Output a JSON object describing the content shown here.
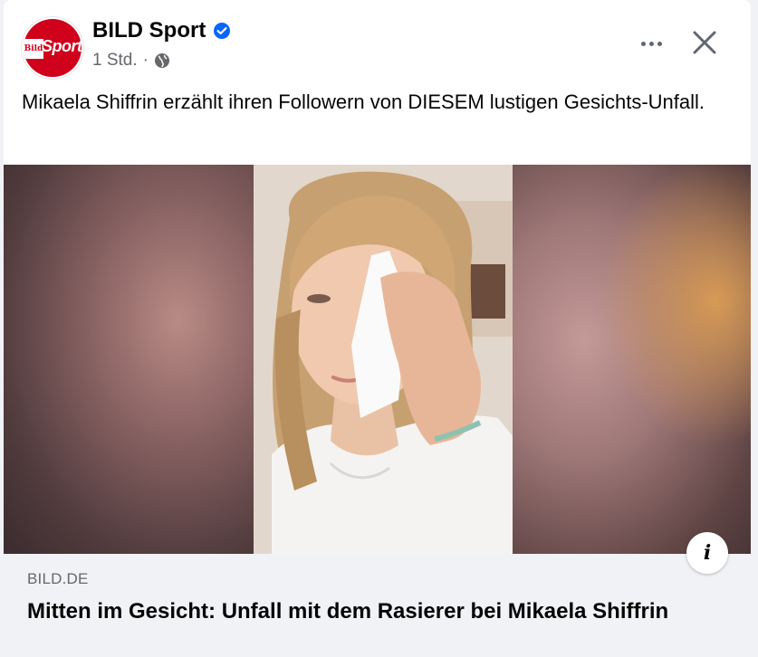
{
  "post": {
    "page_name": "BILD Sport",
    "verified_icon": "verified-badge-icon",
    "timestamp": "1 Std.",
    "separator": "·",
    "audience_icon": "globe-icon",
    "text": "Mikaela Shiffrin erzählt ihren Followern von DIESEM lustigen Gesichts-Unfall.",
    "avatar": {
      "logo_left": "Bild",
      "logo_right": "Sport"
    }
  },
  "actions": {
    "more_icon": "more-options-icon",
    "close_icon": "close-icon"
  },
  "link": {
    "domain": "BILD.DE",
    "title": "Mitten im Gesicht: Unfall mit dem Rasierer bei Mikaela Shiffrin",
    "info_label": "i"
  },
  "colors": {
    "brand_red": "#d0011b",
    "verified_blue": "#0866ff",
    "secondary_text": "#65676b",
    "link_bg": "#f0f2f5"
  }
}
